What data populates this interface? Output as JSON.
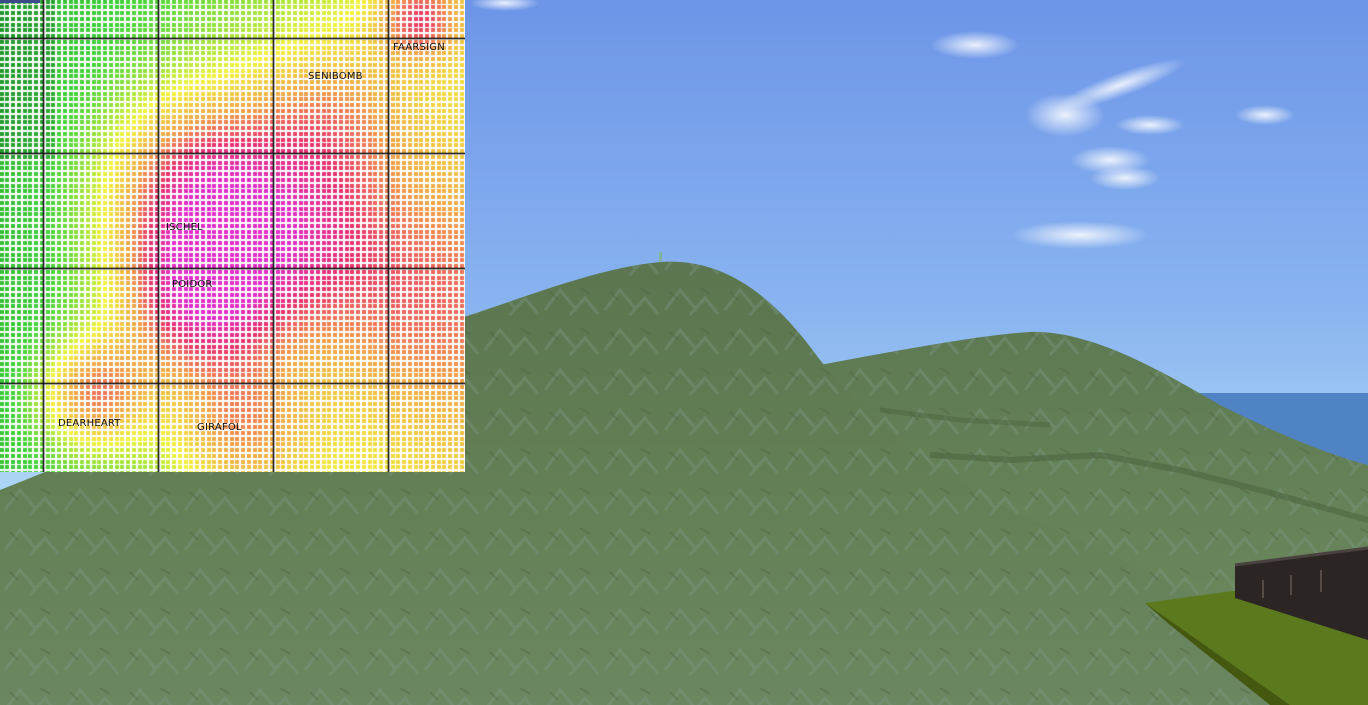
{
  "scene": {
    "sky_top": "#6f97e8",
    "sky_bottom": "#bfe4f6",
    "sea": "#4f83c4",
    "terrain_main": "#5f7a4f",
    "terrain_far": "#6d8459",
    "terrain_dark": "#4f6a42",
    "platform_grass": "#5e7a1f",
    "platform_wall": "#2b2624"
  },
  "minimap": {
    "colors": {
      "green_dark": "#1f8f2a",
      "green": "#3fd13a",
      "yellow": "#f3f33a",
      "orange": "#f0a046",
      "pink": "#e8306a",
      "magenta": "#e02cc8",
      "grid_line": "#000000"
    },
    "regions": [
      {
        "name": "FAARSIGN",
        "key": "faarsign"
      },
      {
        "name": "SENIBOMB",
        "key": "senibomb"
      },
      {
        "name": "ISCHEL",
        "key": "ischel"
      },
      {
        "name": "POIDOR",
        "key": "poidor"
      },
      {
        "name": "DEARHEART",
        "key": "dearheart"
      },
      {
        "name": "GIRAFOL",
        "key": "girafol"
      }
    ]
  }
}
